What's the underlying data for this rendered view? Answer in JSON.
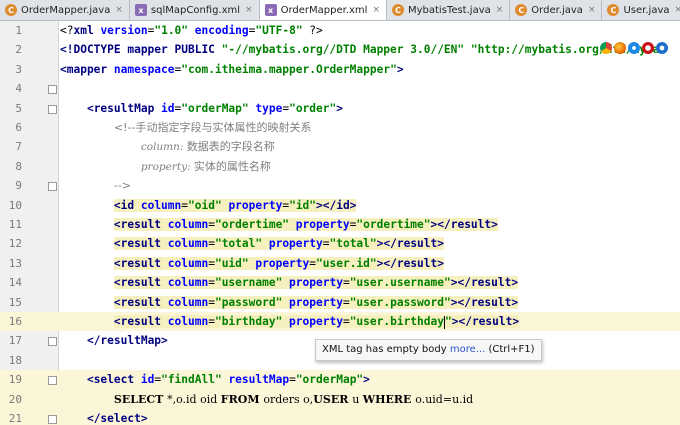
{
  "tabs": [
    {
      "label": "OrderMapper.java",
      "kind": "java",
      "glyph": "C",
      "active": false
    },
    {
      "label": "sqlMapConfig.xml",
      "kind": "xml",
      "glyph": "x",
      "active": false
    },
    {
      "label": "OrderMapper.xml",
      "kind": "xml",
      "glyph": "x",
      "active": true
    },
    {
      "label": "MybatisTest.java",
      "kind": "java",
      "glyph": "C",
      "active": false
    },
    {
      "label": "Order.java",
      "kind": "java",
      "glyph": "C",
      "active": false
    },
    {
      "label": "User.java",
      "kind": "java",
      "glyph": "C",
      "active": false
    }
  ],
  "close_glyph": "×",
  "lines": [
    {
      "n": "1",
      "tokens": [
        [
          "plain",
          "<?"
        ],
        [
          "tag",
          "xml "
        ],
        [
          "attr",
          "version"
        ],
        [
          "plain",
          "="
        ],
        [
          "val",
          "\"1.0\" "
        ],
        [
          "attr",
          "encoding"
        ],
        [
          "plain",
          "="
        ],
        [
          "val",
          "\"UTF-8\" "
        ],
        [
          "plain",
          "?>"
        ]
      ]
    },
    {
      "n": "2",
      "tokens": [
        [
          "tag",
          "<!DOCTYPE mapper PUBLIC "
        ],
        [
          "val",
          "\"-//mybatis.org//DTD Mapper 3.0//EN\" "
        ],
        [
          "val",
          "\"http://mybatis.org/dtd/mybat"
        ]
      ]
    },
    {
      "n": "3",
      "tokens": [
        [
          "tag",
          "<mapper "
        ],
        [
          "attr",
          "namespace"
        ],
        [
          "plain",
          "="
        ],
        [
          "val",
          "\"com.itheima.mapper.OrderMapper\""
        ],
        [
          "tag",
          ">"
        ]
      ]
    },
    {
      "n": "4",
      "tokens": []
    },
    {
      "n": "5",
      "tokens": [
        [
          "plain",
          "    "
        ],
        [
          "tag",
          "<resultMap "
        ],
        [
          "attr",
          "id"
        ],
        [
          "plain",
          "="
        ],
        [
          "val",
          "\"orderMap\" "
        ],
        [
          "attr",
          "type"
        ],
        [
          "plain",
          "="
        ],
        [
          "val",
          "\"order\""
        ],
        [
          "tag",
          ">"
        ]
      ]
    },
    {
      "n": "6",
      "tokens": [
        [
          "plain",
          "        "
        ],
        [
          "cmt",
          "<!--手动指定字段与实体属性的映射关系"
        ]
      ]
    },
    {
      "n": "7",
      "tokens": [
        [
          "plain",
          "            "
        ],
        [
          "cmti",
          "column: "
        ],
        [
          "cmt",
          "数据表的字段名称"
        ]
      ]
    },
    {
      "n": "8",
      "tokens": [
        [
          "plain",
          "            "
        ],
        [
          "cmti",
          "property: "
        ],
        [
          "cmt",
          "实体的属性名称"
        ]
      ]
    },
    {
      "n": "9",
      "tokens": [
        [
          "plain",
          "        "
        ],
        [
          "cmt",
          "-->"
        ]
      ]
    },
    {
      "n": "10",
      "tokens": [
        [
          "plain",
          "        "
        ],
        [
          "tagh",
          "<id "
        ],
        [
          "attrh",
          "column"
        ],
        [
          "plainh",
          "="
        ],
        [
          "valh",
          "\"oid\" "
        ],
        [
          "attrh",
          "property"
        ],
        [
          "plainh",
          "="
        ],
        [
          "valh",
          "\"id\""
        ],
        [
          "tagh",
          "></id>"
        ]
      ]
    },
    {
      "n": "11",
      "tokens": [
        [
          "plain",
          "        "
        ],
        [
          "tagh",
          "<result "
        ],
        [
          "attrh",
          "column"
        ],
        [
          "plainh",
          "="
        ],
        [
          "valh",
          "\"ordertime\" "
        ],
        [
          "attrh",
          "property"
        ],
        [
          "plainh",
          "="
        ],
        [
          "valh",
          "\"ordertime\""
        ],
        [
          "tagh",
          "></result>"
        ]
      ]
    },
    {
      "n": "12",
      "tokens": [
        [
          "plain",
          "        "
        ],
        [
          "tagh",
          "<result "
        ],
        [
          "attrh",
          "column"
        ],
        [
          "plainh",
          "="
        ],
        [
          "valh",
          "\"total\" "
        ],
        [
          "attrh",
          "property"
        ],
        [
          "plainh",
          "="
        ],
        [
          "valh",
          "\"total\""
        ],
        [
          "tagh",
          "></result>"
        ]
      ]
    },
    {
      "n": "13",
      "tokens": [
        [
          "plain",
          "        "
        ],
        [
          "tagh",
          "<result "
        ],
        [
          "attrh",
          "column"
        ],
        [
          "plainh",
          "="
        ],
        [
          "valh",
          "\"uid\" "
        ],
        [
          "attrh",
          "property"
        ],
        [
          "plainh",
          "="
        ],
        [
          "valh",
          "\"user.id\""
        ],
        [
          "tagh",
          "></result>"
        ]
      ]
    },
    {
      "n": "14",
      "tokens": [
        [
          "plain",
          "        "
        ],
        [
          "tagh",
          "<result "
        ],
        [
          "attrh",
          "column"
        ],
        [
          "plainh",
          "="
        ],
        [
          "valh",
          "\"username\" "
        ],
        [
          "attrh",
          "property"
        ],
        [
          "plainh",
          "="
        ],
        [
          "valh",
          "\"user.username\""
        ],
        [
          "tagh",
          "></result>"
        ]
      ]
    },
    {
      "n": "15",
      "tokens": [
        [
          "plain",
          "        "
        ],
        [
          "tagh",
          "<result "
        ],
        [
          "attrh",
          "column"
        ],
        [
          "plainh",
          "="
        ],
        [
          "valh",
          "\"password\" "
        ],
        [
          "attrh",
          "property"
        ],
        [
          "plainh",
          "="
        ],
        [
          "valh",
          "\"user.password\""
        ],
        [
          "tagh",
          "></result>"
        ]
      ]
    },
    {
      "n": "16",
      "tokens": [
        [
          "plain",
          "        "
        ],
        [
          "tagh",
          "<result "
        ],
        [
          "attrh",
          "column"
        ],
        [
          "plainh",
          "="
        ],
        [
          "valh",
          "\"birthday\" "
        ],
        [
          "attrh",
          "property"
        ],
        [
          "plainh",
          "="
        ],
        [
          "valh",
          "\"user.birthday"
        ],
        [
          "caret",
          ""
        ],
        [
          "valh",
          "\""
        ],
        [
          "tagh",
          "></result>"
        ]
      ]
    },
    {
      "n": "17",
      "tokens": [
        [
          "plain",
          "    "
        ],
        [
          "tag",
          "</resultMap>"
        ]
      ]
    },
    {
      "n": "18",
      "tokens": []
    },
    {
      "n": "19",
      "tokens": [
        [
          "plain",
          "    "
        ],
        [
          "tag",
          "<select "
        ],
        [
          "attr",
          "id"
        ],
        [
          "plain",
          "="
        ],
        [
          "val",
          "\"findAll\" "
        ],
        [
          "attr",
          "resultMap"
        ],
        [
          "plain",
          "="
        ],
        [
          "val",
          "\"orderMap\""
        ],
        [
          "tag",
          ">"
        ]
      ]
    },
    {
      "n": "20",
      "tokens": [
        [
          "plain",
          "        "
        ],
        [
          "sqlkw",
          "SELECT "
        ],
        [
          "sql",
          "*,o.id oid "
        ],
        [
          "sqlkw",
          "FROM "
        ],
        [
          "sql",
          "orders o,"
        ],
        [
          "sqlkw",
          "USER "
        ],
        [
          "sql",
          "u "
        ],
        [
          "sqlkw",
          "WHERE "
        ],
        [
          "sql",
          "o.uid=u.id"
        ]
      ]
    },
    {
      "n": "21",
      "tokens": [
        [
          "plain",
          "    "
        ],
        [
          "tag",
          "</select>"
        ]
      ]
    }
  ],
  "current_line": "16",
  "sql_block_lines": [
    "19",
    "20",
    "21"
  ],
  "tooltip": {
    "text": "XML tag has empty body ",
    "more": "more...",
    "shortcut": " (Ctrl+F1)"
  },
  "colors": {
    "tag": "#000080",
    "attribute": "#0000ff",
    "value": "#008000",
    "comment": "#808080",
    "highlight": "#f6efbe"
  }
}
